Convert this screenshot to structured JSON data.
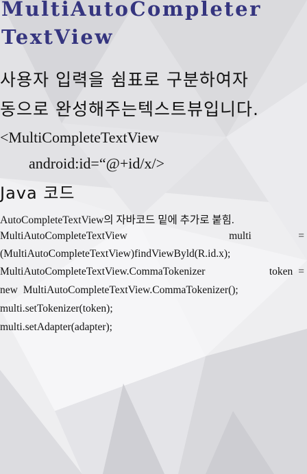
{
  "colors": {
    "title": "#35357f",
    "text": "#111111"
  },
  "title": {
    "line1": "MultiAutoCompleter",
    "line2": "TextView"
  },
  "description": {
    "line1": " 사용자 입력을 쉼표로 구분하여자",
    "line2": "동으로 완성해주는텍스트뷰입니다."
  },
  "xml": {
    "line1": "<MultiCompleteTextView",
    "line2": "android:id=“@+id/x/>"
  },
  "java_heading": "Java 코드",
  "code": {
    "note": "AutoCompleteTextView의 자바코드 밑에 추가로 붙힘.",
    "line1": [
      "MultiAutoCompleteTextView",
      "multi",
      "="
    ],
    "line2": "(MultiAutoCompleteTextView)findViewByld(R.id.x);",
    "line3": [
      "MultiAutoCompleteTextView.CommaTokenizer",
      "token",
      "="
    ],
    "line4": "new MultiAutoCompleteTextView.CommaTokenizer();",
    "line5": "multi.setTokenizer(token);",
    "line6": "multi.setAdapter(adapter);"
  }
}
